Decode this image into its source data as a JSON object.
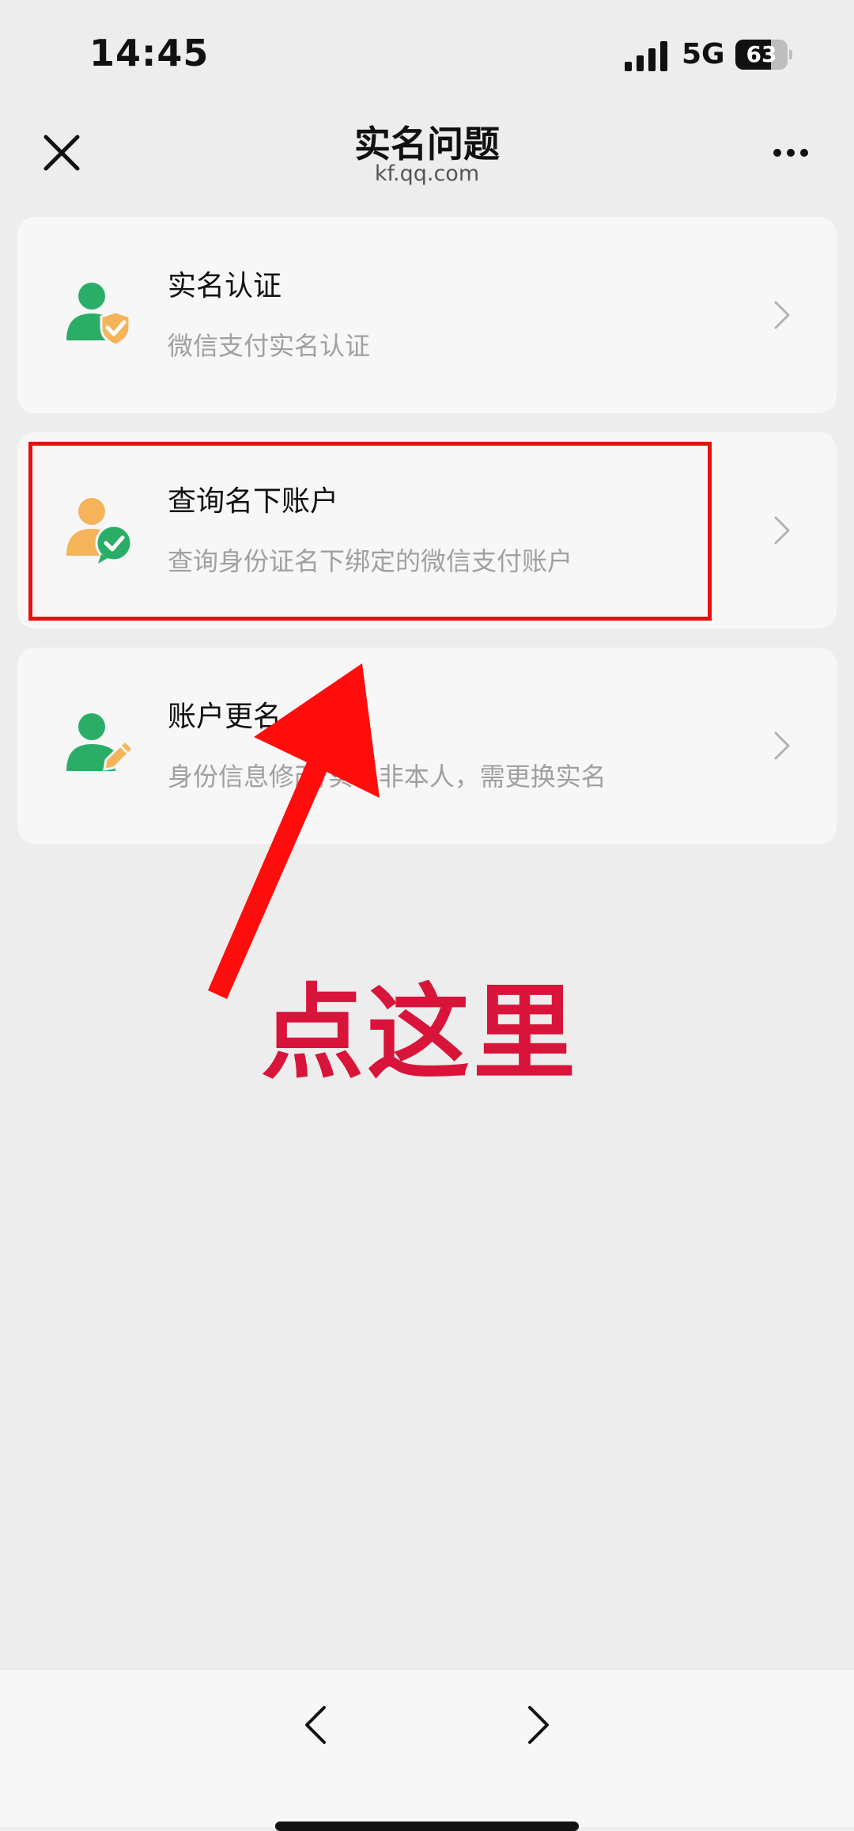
{
  "status_bar": {
    "time": "14:45",
    "network": "5G",
    "battery": "63"
  },
  "header": {
    "title": "实名问题",
    "subtitle": "kf.qq.com"
  },
  "menu_items": [
    {
      "label": "实名认证",
      "desc": "微信支付实名认证",
      "icon": "user-shield-icon"
    },
    {
      "label": "查询名下账户",
      "desc": "查询身份证名下绑定的微信支付账户",
      "icon": "user-check-icon"
    },
    {
      "label": "账户更名",
      "desc": "身份信息修改/实名非本人，需更换实名",
      "icon": "user-edit-icon"
    }
  ],
  "annotation": {
    "text": "点这里"
  },
  "colors": {
    "green": "#2aae67",
    "orange": "#f5b45a",
    "highlight_red": "#e81010",
    "annotation_red": "#d8143a"
  }
}
